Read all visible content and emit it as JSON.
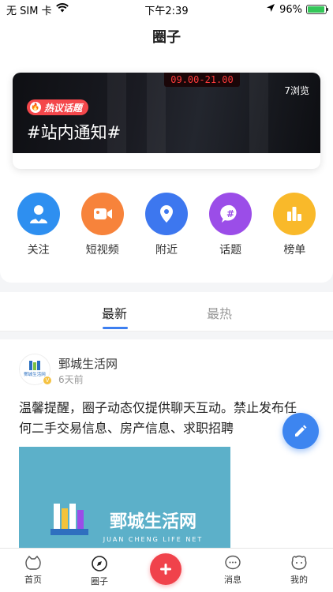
{
  "status_bar": {
    "carrier": "无 SIM 卡",
    "time": "下午2:39",
    "battery": "96%",
    "battery_level": 0.96
  },
  "header": {
    "title": "圈子"
  },
  "banner": {
    "sign_text": "09.00-21.00",
    "views": "7浏览",
    "tag_label": "热议话题",
    "topic": "#站内通知#"
  },
  "quick_links": [
    {
      "label": "关注",
      "icon": "user-heart-icon",
      "color": "#2e8ff0"
    },
    {
      "label": "短视频",
      "icon": "video-icon",
      "color": "#f7833b"
    },
    {
      "label": "附近",
      "icon": "location-pin-icon",
      "color": "#3d77ef"
    },
    {
      "label": "话题",
      "icon": "hashtag-bubble-icon",
      "color": "#9b4de8"
    },
    {
      "label": "榜单",
      "icon": "bar-chart-icon",
      "color": "#f9b92a"
    }
  ],
  "feed_tabs": {
    "latest": "最新",
    "hot": "最热"
  },
  "post": {
    "author": "鄄城生活网",
    "time": "6天前",
    "content": "温馨提醒，圈子动态仅提供聊天互动。禁止发布任何二手交易信息、房产信息、求职招聘",
    "avatar_text": "鄄城生活网",
    "image_title": "鄄城生活网",
    "image_subtitle": "JUAN CHENG LIFE NET"
  },
  "bottom_nav": {
    "home": "首页",
    "circle": "圈子",
    "messages": "消息",
    "mine": "我的"
  },
  "colors": {
    "accent_blue": "#3d7ff0",
    "accent_red": "#f0424b"
  }
}
